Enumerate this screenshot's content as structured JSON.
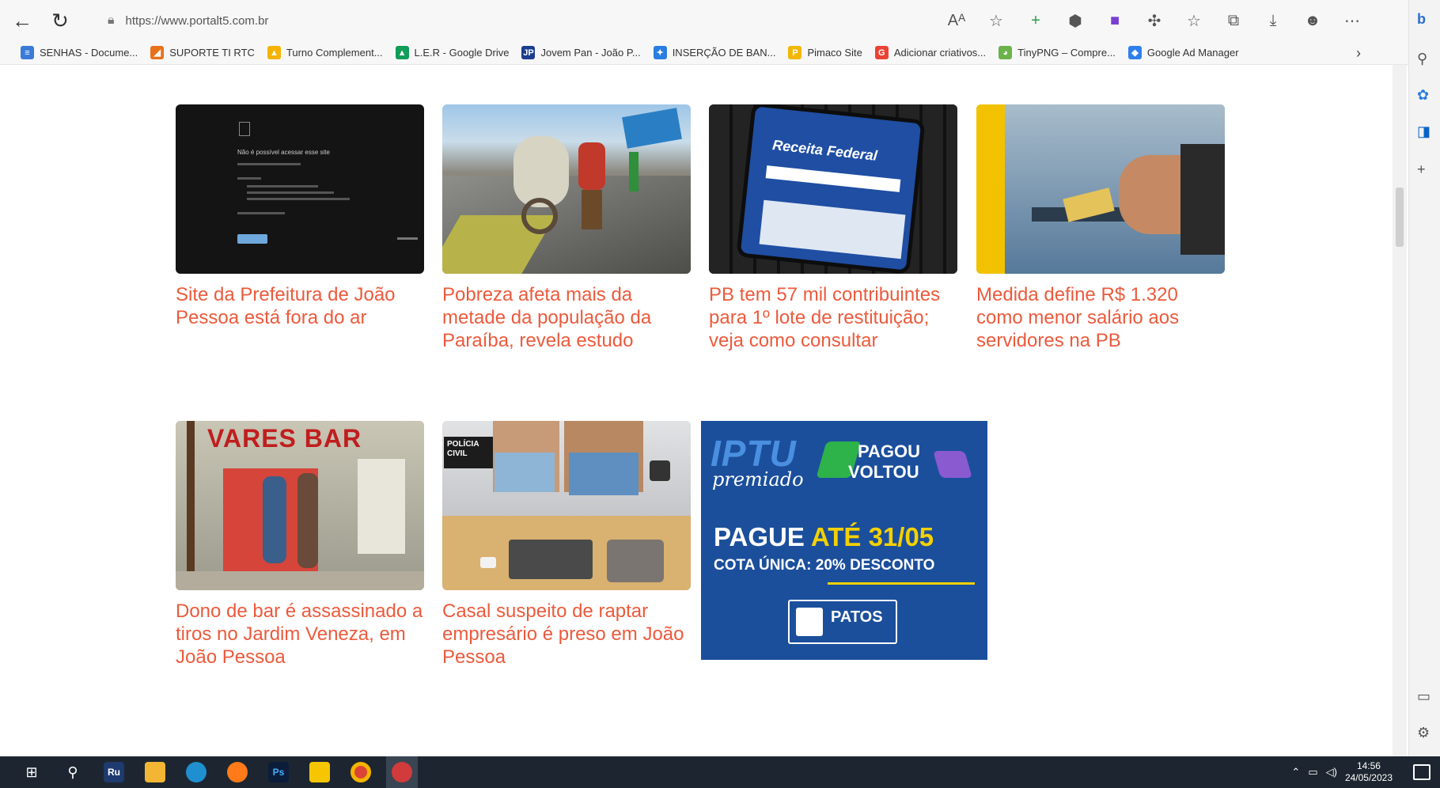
{
  "browser": {
    "url": "https://www.portalt5.com.br",
    "bookmarks": [
      {
        "label": "SENHAS - Docume...",
        "color": "#3b7bd8",
        "glyph": "≡"
      },
      {
        "label": "SUPORTE TI RTC",
        "color": "#e9711c",
        "glyph": "◢"
      },
      {
        "label": "Turno Complement...",
        "color": "#f4b400",
        "glyph": "▲"
      },
      {
        "label": "L.E.R - Google Drive",
        "color": "#0f9d58",
        "glyph": "▲"
      },
      {
        "label": "Jovem Pan - João P...",
        "color": "#1a3d8f",
        "glyph": "JP"
      },
      {
        "label": "INSERÇÃO DE BAN...",
        "color": "#2a7de1",
        "glyph": "✦"
      },
      {
        "label": "Pimaco Site",
        "color": "#f2b705",
        "glyph": "P"
      },
      {
        "label": "Adicionar criativos...",
        "color": "#ea4335",
        "glyph": "G"
      },
      {
        "label": "TinyPNG – Compre...",
        "color": "#6bb34a",
        "glyph": "◕"
      },
      {
        "label": "Google Ad Manager",
        "color": "#2f80ed",
        "glyph": "◆"
      }
    ],
    "more_label": "›"
  },
  "articles": [
    {
      "title": "Site da Prefeitura de João Pessoa está fora do ar",
      "image": "error-page-screenshot"
    },
    {
      "title": "Pobreza afeta mais da metade da população da Paraíba, revela estudo",
      "image": "street-cart-photo"
    },
    {
      "title": "PB tem 57 mil contribuintes para 1º lote de restituição; veja como consultar",
      "image": "receita-federal-phone"
    },
    {
      "title": "Medida define R$ 1.320 como menor salário aos servidores na PB",
      "image": "atm-cash-photo"
    },
    {
      "title": "Dono de bar é assassinado a tiros no Jardim Veneza, em João Pessoa",
      "image": "bar-storefront-photo"
    },
    {
      "title": "Casal suspeito de raptar empresário é preso em João Pessoa",
      "image": "police-suspects-photo"
    }
  ],
  "thumbs": {
    "error_title": "Não é possível acessar esse site",
    "bar_sign": "VARES BAR",
    "policia": "POLÍCIA CIVIL",
    "receita": "Receita Federal"
  },
  "ad": {
    "brand": "IPTU",
    "brand_sub": "premiado",
    "pagou": "PAGOU",
    "voltou": "VOLTOU",
    "pague": "PAGUE",
    "ate": "ATÉ 31/05",
    "cota": "COTA ÚNICA: 20% DESCONTO",
    "city": "PATOS",
    "colors": {
      "bg": "#1b4f9c",
      "yellow": "#f5d000",
      "green": "#2db34a"
    }
  },
  "taskbar": {
    "time": "14:56",
    "date": "24/05/2023"
  }
}
